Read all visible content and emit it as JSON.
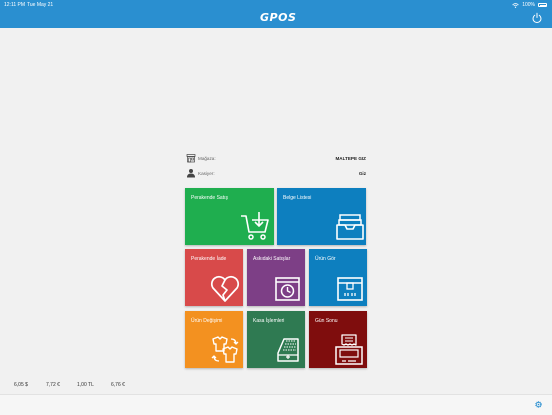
{
  "status_bar": {
    "time": "12:11 PM",
    "date": "Tue May 21",
    "battery": "100%"
  },
  "header": {
    "logo_text": "GPOS",
    "accent_color": "#2a8fd0"
  },
  "info": {
    "store_label": "Mağaza:",
    "store_value": "MALTEPE GIZ",
    "cashier_label": "Kasiyer:",
    "cashier_value": "Giz"
  },
  "tiles": {
    "retail_sale": {
      "label": "Perakende Satış",
      "color": "#1fae4f",
      "icon": "cart-icon"
    },
    "document_list": {
      "label": "Belge Listesi",
      "color": "#0d7fbf",
      "icon": "inbox-tray-icon"
    },
    "retail_return": {
      "label": "Perakende İade",
      "color": "#d84a4a",
      "icon": "broken-heart-icon"
    },
    "pending_sales": {
      "label": "Askıdaki Satışlar",
      "color": "#7d3f86",
      "icon": "clock-box-icon"
    },
    "product_view": {
      "label": "Ürün Gör",
      "color": "#0d7fbf",
      "icon": "package-box-icon"
    },
    "product_exchange": {
      "label": "Ürün Değişimi",
      "color": "#f39120",
      "icon": "shirt-exchange-icon"
    },
    "cash_operations": {
      "label": "Kasa İşlemleri",
      "color": "#2f7a52",
      "icon": "cash-register-icon"
    },
    "end_of_day": {
      "label": "Gün Sonu",
      "color": "#7f0d0d",
      "icon": "receipt-printer-icon"
    }
  },
  "currency": {
    "usd": "6,05 $",
    "eur": "7,72 €",
    "tl": "1,00 TL",
    "eur2": "6,76 €"
  }
}
